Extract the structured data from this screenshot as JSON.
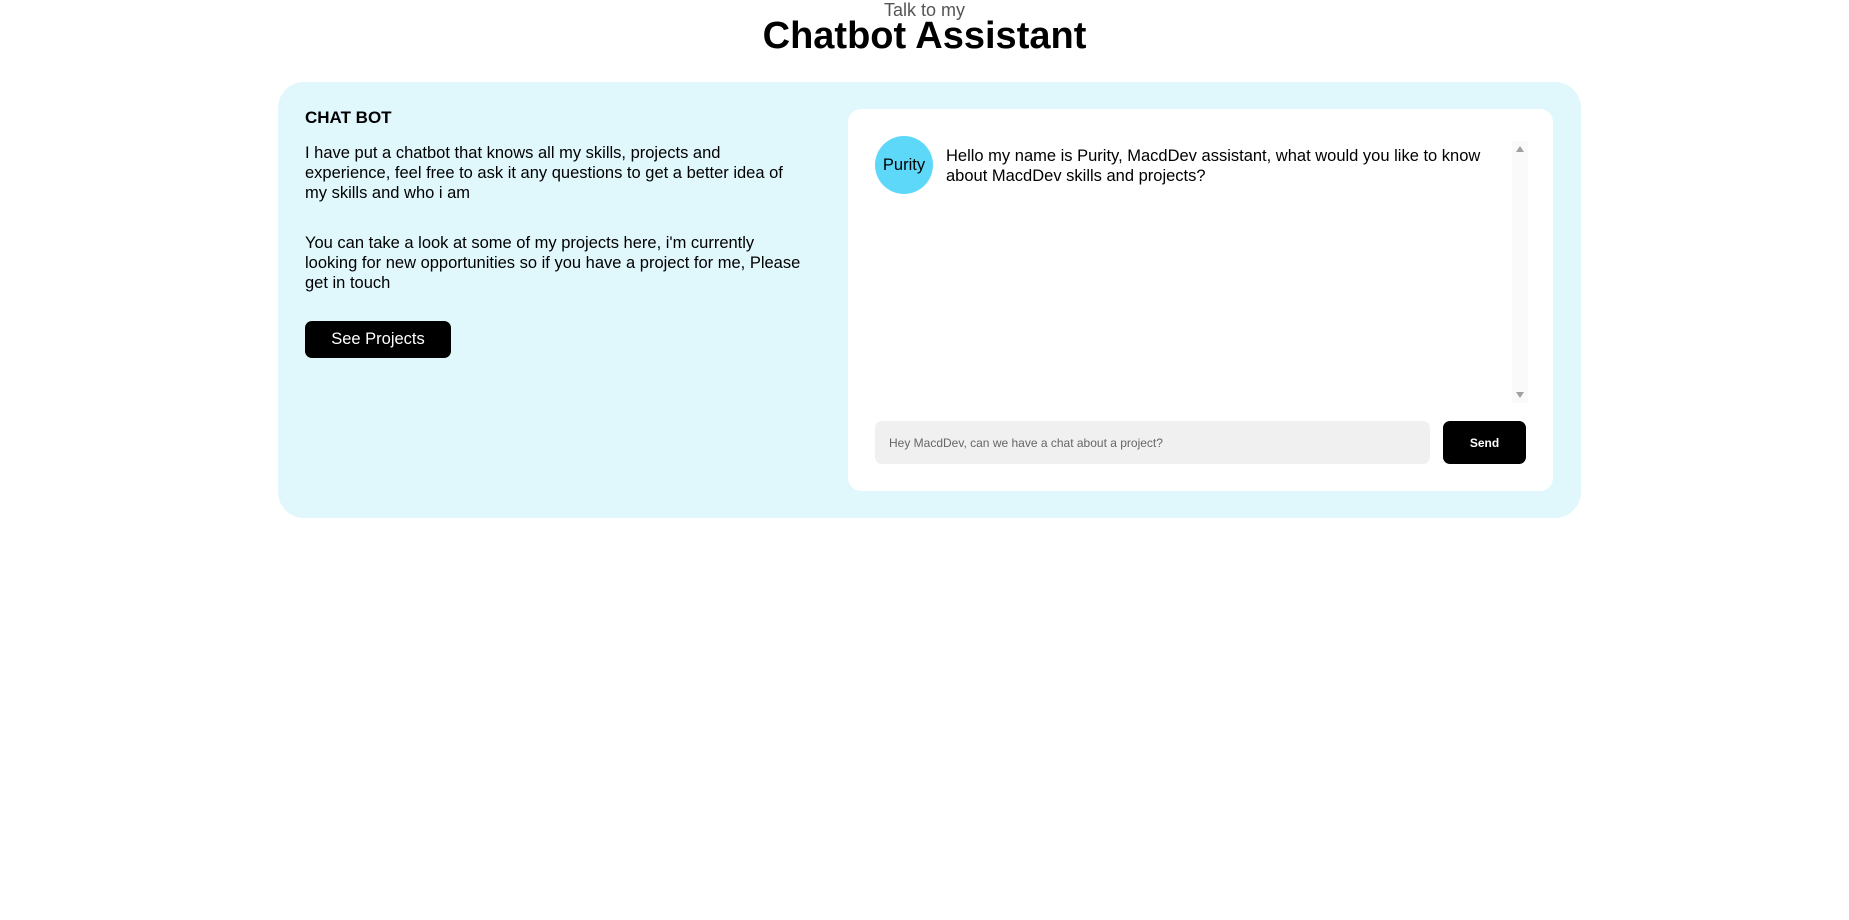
{
  "header": {
    "subtitle": "Talk to my",
    "title": "Chatbot Assistant"
  },
  "intro": {
    "heading": "CHAT BOT",
    "paragraph1": "I have put a chatbot that knows all my skills, projects and experience, feel free to ask it any questions to get a better idea of my skills and who i am",
    "paragraph2": "You can take a look at some of my projects here, i'm currently looking for new opportunities so if you have a project for me, Please get in touch",
    "button_label": "See Projects"
  },
  "chat": {
    "messages": [
      {
        "sender": "Purity",
        "text": "Hello my name is Purity, MacdDev assistant, what would you like to know about MacdDev skills and projects?"
      }
    ],
    "input_value": "",
    "input_placeholder": "Hey MacdDev, can we have a chat about a project?",
    "send_label": "Send",
    "avatar_color": "#5dd8f8"
  },
  "colors": {
    "panel_bg": "#e0f7fc",
    "button_bg": "#000000"
  }
}
